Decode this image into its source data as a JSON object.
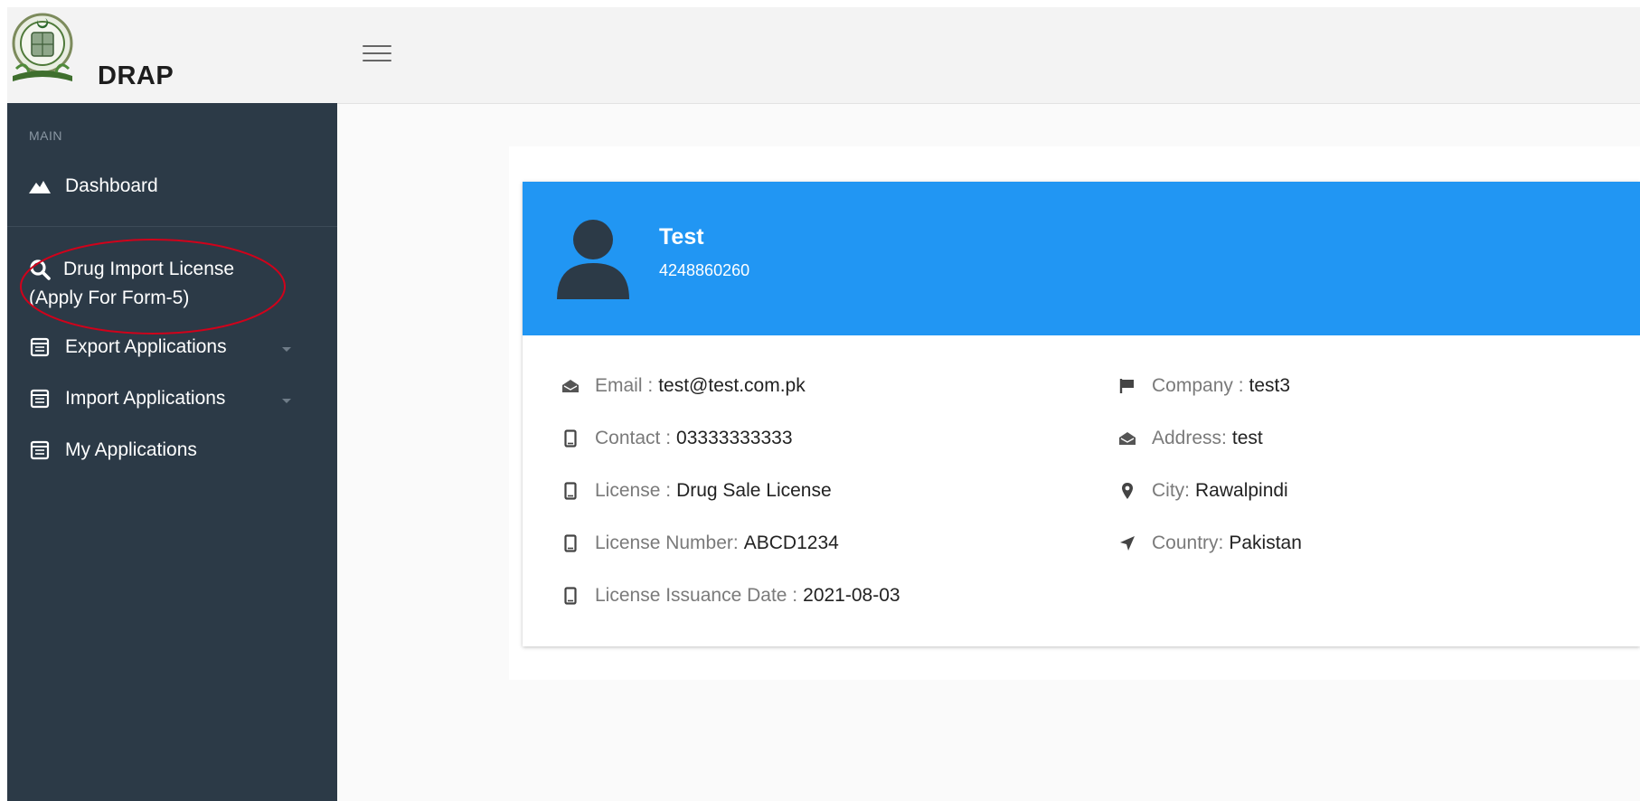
{
  "brand": {
    "name": "DRAP"
  },
  "sidebar": {
    "section_label": "MAIN",
    "items": [
      {
        "label": "Dashboard",
        "icon": "mountain-icon"
      },
      {
        "label_line1": "Drug Import License",
        "label_line2": "(Apply For Form-5)",
        "icon": "search-icon"
      },
      {
        "label": "Export Applications",
        "icon": "calendar-icon"
      },
      {
        "label": "Import Applications",
        "icon": "calendar-icon"
      },
      {
        "label": "My Applications",
        "icon": "calendar-icon"
      }
    ]
  },
  "profile": {
    "name": "Test",
    "id_number": "4248860260",
    "left": [
      {
        "label": "Email :",
        "value": "test@test.com.pk",
        "icon": "envelope-open-icon"
      },
      {
        "label": "Contact :",
        "value": "03333333333",
        "icon": "mobile-icon"
      },
      {
        "label": "License :",
        "value": "Drug Sale License",
        "icon": "mobile-icon"
      },
      {
        "label": "License Number:",
        "value": "ABCD1234",
        "icon": "mobile-icon"
      },
      {
        "label": "License Issuance Date :",
        "value": "2021-08-03",
        "icon": "mobile-icon"
      }
    ],
    "right": [
      {
        "label": "Company :",
        "value": "test3",
        "icon": "flag-icon"
      },
      {
        "label": "Address:",
        "value": "test",
        "icon": "envelope-open-icon"
      },
      {
        "label": "City:",
        "value": "Rawalpindi",
        "icon": "map-marker-icon"
      },
      {
        "label": "Country:",
        "value": "Pakistan",
        "icon": "location-arrow-icon"
      }
    ]
  },
  "colors": {
    "sidebar_bg": "#2c3a47",
    "header_blue": "#2196f3",
    "highlight_ellipse": "#d0021b"
  }
}
